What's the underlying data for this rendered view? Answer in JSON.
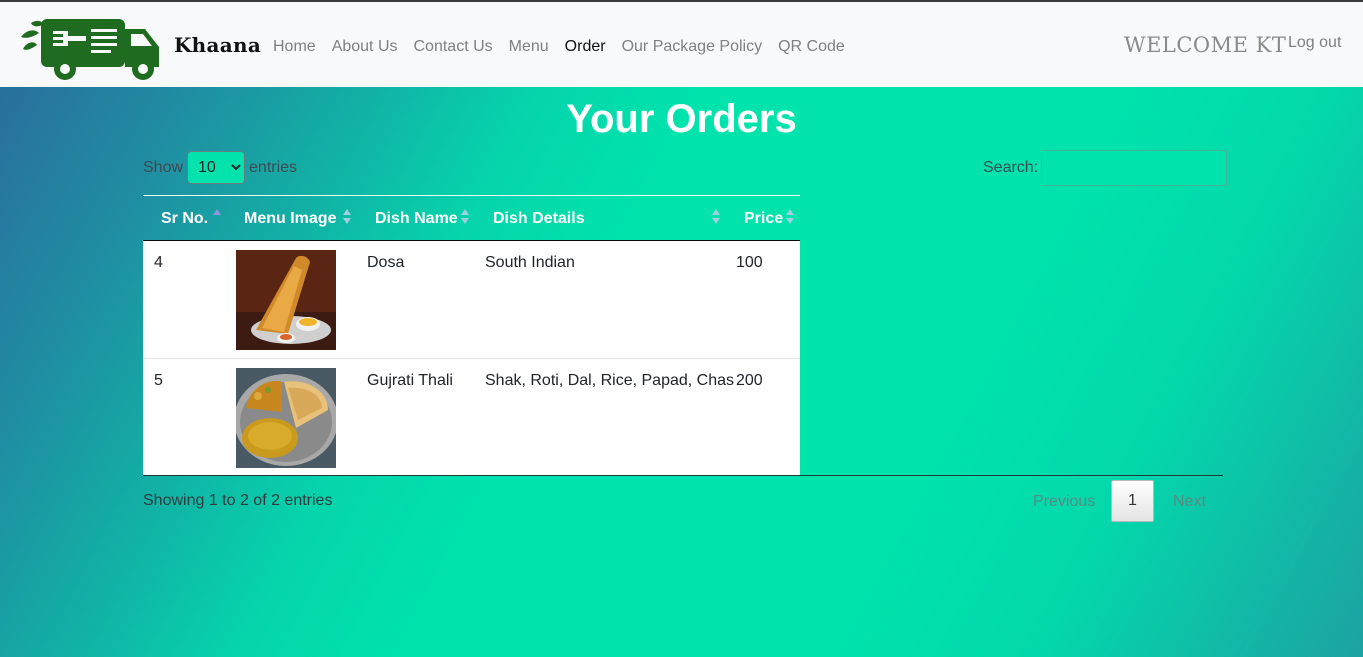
{
  "nav": {
    "brand": "Khaana",
    "links": [
      {
        "label": "Home"
      },
      {
        "label": "About Us"
      },
      {
        "label": "Contact Us"
      },
      {
        "label": "Menu"
      },
      {
        "label": "Order"
      },
      {
        "label": "Our Package Policy"
      },
      {
        "label": "QR Code"
      }
    ],
    "welcome": "WELCOME KT",
    "logout": "Log out",
    "logo_color": "#1f6b1f"
  },
  "page": {
    "title": "Your Orders",
    "show_label": "Show",
    "entries_label": "entries",
    "page_length": "10",
    "search_label": "Search:",
    "search_value": ""
  },
  "table": {
    "columns": [
      "Sr No.",
      "Menu Image",
      "Dish Name",
      "Dish Details",
      "Price"
    ],
    "rows": [
      {
        "sr": "4",
        "image": "dosa-image",
        "name": "Dosa",
        "details": "South Indian",
        "price": "100"
      },
      {
        "sr": "5",
        "image": "gujrati-thali-image",
        "name": "Gujrati Thali",
        "details": "Shak, Roti, Dal, Rice, Papad, Chas",
        "price": "200"
      }
    ]
  },
  "footer": {
    "info": "Showing 1 to 2 of 2 entries",
    "previous": "Previous",
    "current_page": "1",
    "next": "Next"
  },
  "colors": {
    "accent": "#00e3ad",
    "gradient_dark": "#2a6f9e"
  }
}
